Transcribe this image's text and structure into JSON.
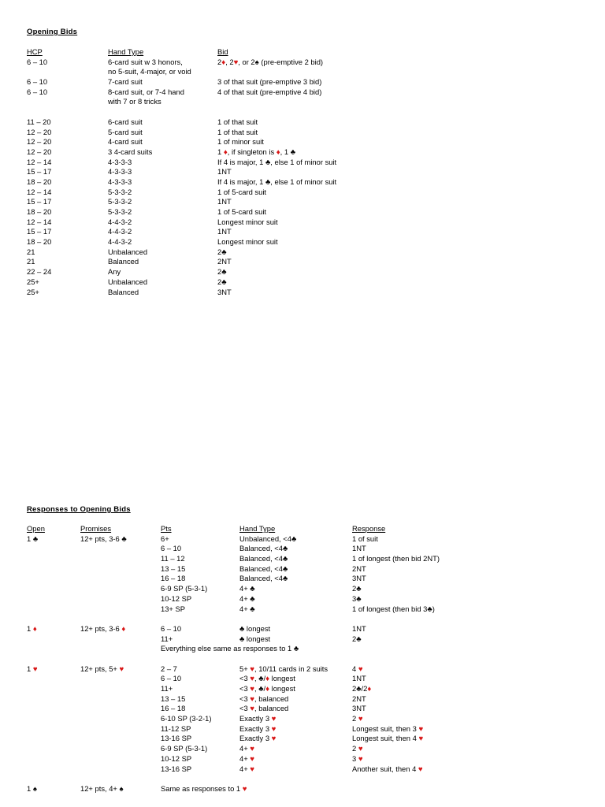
{
  "document": {
    "sections": [
      {
        "id": "opening-bids",
        "title": "Opening Bids",
        "headers": {
          "hcp": "HCP",
          "hand_type": "Hand Type",
          "bid": "Bid"
        },
        "rows": [
          {
            "hcp": "6 – 10",
            "hand_type": "6-card suit w 3 honors,",
            "bid": "2♦, 2♥, or 2♠ (pre-emptive 2 bid)"
          },
          {
            "hcp": "",
            "hand_type": "no 5-suit, 4-major, or void",
            "bid": ""
          },
          {
            "hcp": "6 – 10",
            "hand_type": "7-card suit",
            "bid": "3 of that suit (pre-emptive 3 bid)"
          },
          {
            "hcp": "6 – 10",
            "hand_type": "8-card suit, or 7-4 hand",
            "bid": "4 of that suit (pre-emptive 4 bid)"
          },
          {
            "hcp": "",
            "hand_type": "with 7 or 8 tricks",
            "bid": ""
          },
          {
            "hcp": "11 – 20",
            "hand_type": "6-card suit",
            "bid": "1 of that suit"
          },
          {
            "hcp": "12 – 20",
            "hand_type": "5-card suit",
            "bid": "1 of that suit"
          },
          {
            "hcp": "12 – 20",
            "hand_type": "4-card suit",
            "bid": "1 of minor suit"
          },
          {
            "hcp": "12 – 20",
            "hand_type": "3 4-card suits",
            "bid": "1 ♦, if singleton is ♦, 1 ♣"
          },
          {
            "hcp": "12 – 14",
            "hand_type": "4-3-3-3",
            "bid": "If 4 is major, 1 ♣, else 1 of minor suit"
          },
          {
            "hcp": "15 – 17",
            "hand_type": "4-3-3-3",
            "bid": "1NT"
          },
          {
            "hcp": "18 – 20",
            "hand_type": "4-3-3-3",
            "bid": "If 4 is major, 1 ♣, else 1 of minor suit"
          },
          {
            "hcp": "12 – 14",
            "hand_type": "5-3-3-2",
            "bid": "1 of 5-card suit"
          },
          {
            "hcp": "15 – 17",
            "hand_type": "5-3-3-2",
            "bid": "1NT"
          },
          {
            "hcp": "18 – 20",
            "hand_type": "5-3-3-2",
            "bid": "1 of 5-card suit"
          },
          {
            "hcp": "12 – 14",
            "hand_type": "4-4-3-2",
            "bid": "Longest minor suit"
          },
          {
            "hcp": "15 – 17",
            "hand_type": "4-4-3-2",
            "bid": "1NT"
          },
          {
            "hcp": "18 – 20",
            "hand_type": "4-4-3-2",
            "bid": "Longest minor suit"
          },
          {
            "hcp": "21",
            "hand_type": "Unbalanced",
            "bid": "2♣"
          },
          {
            "hcp": "21",
            "hand_type": "Balanced",
            "bid": "2NT"
          },
          {
            "hcp": "22 – 24",
            "hand_type": "Any",
            "bid": "2♣"
          },
          {
            "hcp": "25+",
            "hand_type": "Unbalanced",
            "bid": "2♣"
          },
          {
            "hcp": "25+",
            "hand_type": "Balanced",
            "bid": "3NT"
          }
        ]
      },
      {
        "id": "responses-to-opening-bids",
        "title": "Responses to Opening Bids",
        "headers": {
          "open": "Open",
          "promises": "Promises",
          "pts": "Pts",
          "hand_type": "Hand Type",
          "response": "Response"
        },
        "rows": [
          {
            "open": "1 ♣",
            "promises": "12+ pts, 3-6 ♣",
            "pts": "6+",
            "hand_type": "Unbalanced, <4♣",
            "response": "1 of suit"
          },
          {
            "open": "",
            "promises": "",
            "pts": "6 – 10",
            "hand_type": "Balanced, <4♣",
            "response": "1NT"
          },
          {
            "open": "",
            "promises": "",
            "pts": "11 – 12",
            "hand_type": "Balanced, <4♣",
            "response": "1 of longest (then bid 2NT)"
          },
          {
            "open": "",
            "promises": "",
            "pts": "13 – 15",
            "hand_type": "Balanced, <4♣",
            "response": "2NT"
          },
          {
            "open": "",
            "promises": "",
            "pts": "16 – 18",
            "hand_type": "Balanced, <4♣",
            "response": "3NT"
          },
          {
            "open": "",
            "promises": "",
            "pts": "6-9 SP (5-3-1)",
            "hand_type": "4+ ♣",
            "response": "2♣"
          },
          {
            "open": "",
            "promises": "",
            "pts": "10-12 SP",
            "hand_type": "4+ ♣",
            "response": "3♣"
          },
          {
            "open": "",
            "promises": "",
            "pts": "13+ SP",
            "hand_type": "4+ ♣",
            "response": "1 of longest (then bid 3♣)"
          },
          {
            "open": "1 ♦",
            "promises": "12+ pts, 3-6 ♦",
            "pts": "6 – 10",
            "hand_type": "♣ longest",
            "response": "1NT",
            "group_start": true
          },
          {
            "open": "",
            "promises": "",
            "pts": "11+",
            "hand_type": "♣ longest",
            "response": "2♣"
          },
          {
            "open": "",
            "promises": "",
            "note": "Everything else same as responses to 1 ♣"
          },
          {
            "open": "1 ♥",
            "promises": "12+ pts, 5+ ♥",
            "pts": "2 – 7",
            "hand_type": "5+ ♥, 10/11 cards in 2 suits",
            "response": "4 ♥",
            "group_start": true
          },
          {
            "open": "",
            "promises": "",
            "pts": "6 – 10",
            "hand_type": "<3 ♥, ♣/♦ longest",
            "response": "1NT"
          },
          {
            "open": "",
            "promises": "",
            "pts": "11+",
            "hand_type": "<3 ♥, ♣/♦ longest",
            "response": "2♣/2♦"
          },
          {
            "open": "",
            "promises": "",
            "pts": "13 – 15",
            "hand_type": "<3 ♥, balanced",
            "response": "2NT"
          },
          {
            "open": "",
            "promises": "",
            "pts": "16 – 18",
            "hand_type": "<3 ♥, balanced",
            "response": "3NT"
          },
          {
            "open": "",
            "promises": "",
            "pts": "6-10 SP (3-2-1)",
            "hand_type": "Exactly 3 ♥",
            "response": "2 ♥"
          },
          {
            "open": "",
            "promises": "",
            "pts": "11-12 SP",
            "hand_type": "Exactly 3 ♥",
            "response": "Longest suit, then 3 ♥"
          },
          {
            "open": "",
            "promises": "",
            "pts": "13-16 SP",
            "hand_type": "Exactly 3 ♥",
            "response": "Longest suit, then 4 ♥"
          },
          {
            "open": "",
            "promises": "",
            "pts": "6-9 SP (5-3-1)",
            "hand_type": "4+ ♥",
            "response": "2 ♥"
          },
          {
            "open": "",
            "promises": "",
            "pts": "10-12 SP",
            "hand_type": "4+ ♥",
            "response": "3 ♥"
          },
          {
            "open": "",
            "promises": "",
            "pts": "13-16 SP",
            "hand_type": "4+ ♥",
            "response": "Another suit, then 4 ♥"
          },
          {
            "open": "1 ♠",
            "promises": "12+ pts, 4+ ♠",
            "note": "Same as responses to 1 ♥",
            "group_start": true
          }
        ]
      }
    ]
  },
  "colors": {
    "red_suit": "#d81616",
    "black_suit": "#000000",
    "text": "#000000",
    "background": "#ffffff"
  }
}
